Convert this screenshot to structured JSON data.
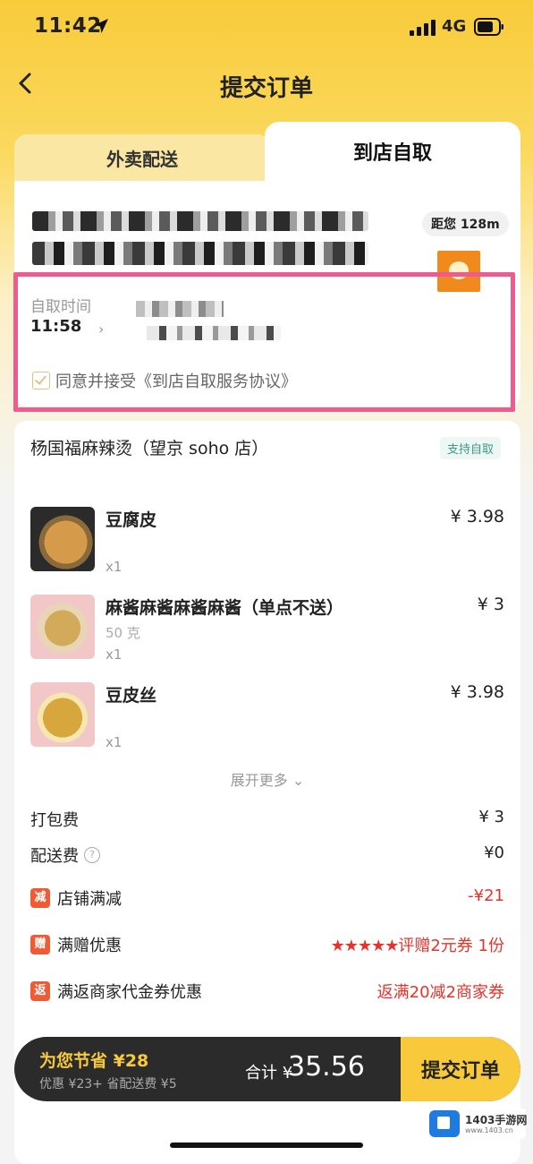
{
  "status": {
    "time": "11:42",
    "network": "4G"
  },
  "nav": {
    "title": "提交订单"
  },
  "tabs": [
    {
      "label": "外卖配送"
    },
    {
      "label": "到店自取"
    }
  ],
  "pickup": {
    "distance": "距您 128m",
    "time_label": "自取时间",
    "time_value": "11:58",
    "agreement": "同意并接受《到店自取服务协议》"
  },
  "shop": {
    "name": "杨国福麻辣烫（望京 soho 店）",
    "tag": "支持自取"
  },
  "items": [
    {
      "name": "豆腐皮",
      "sub": "",
      "qty": "x1",
      "price": "¥ 3.98"
    },
    {
      "name": "麻酱麻酱麻酱麻酱（单点不送）",
      "sub": "50 克",
      "qty": "x1",
      "price": "¥ 3"
    },
    {
      "name": "豆皮丝",
      "sub": "",
      "qty": "x1",
      "price": "¥ 3.98"
    }
  ],
  "expand_more": "展开更多 ⌄",
  "fees": {
    "packing": {
      "label": "打包费",
      "value": "¥ 3"
    },
    "delivery": {
      "label": "配送费",
      "value": "¥0"
    },
    "reduce": {
      "icon": "减",
      "label": "店铺满减",
      "value": "-¥21"
    },
    "gift": {
      "icon": "赠",
      "label": "满赠优惠",
      "stars": "★★★★★",
      "value": "评赠2元券 1份"
    },
    "return": {
      "icon": "返",
      "label": "满返商家代金券优惠",
      "value": "返满20减2商家券"
    }
  },
  "bottom": {
    "save_title": "为您节省 ¥28",
    "save_sub": "优惠 ¥23+ 省配送费 ¥5",
    "total_label": "合计 ¥",
    "total_value": "35.56",
    "submit": "提交订单"
  },
  "watermark": {
    "name": "1403手游网",
    "url": "www.1403.cn"
  },
  "colors": {
    "accent": "#f8cb3a",
    "highlight": "#ee5b8f",
    "red": "#e8332a",
    "dark": "#2b2b2b"
  }
}
